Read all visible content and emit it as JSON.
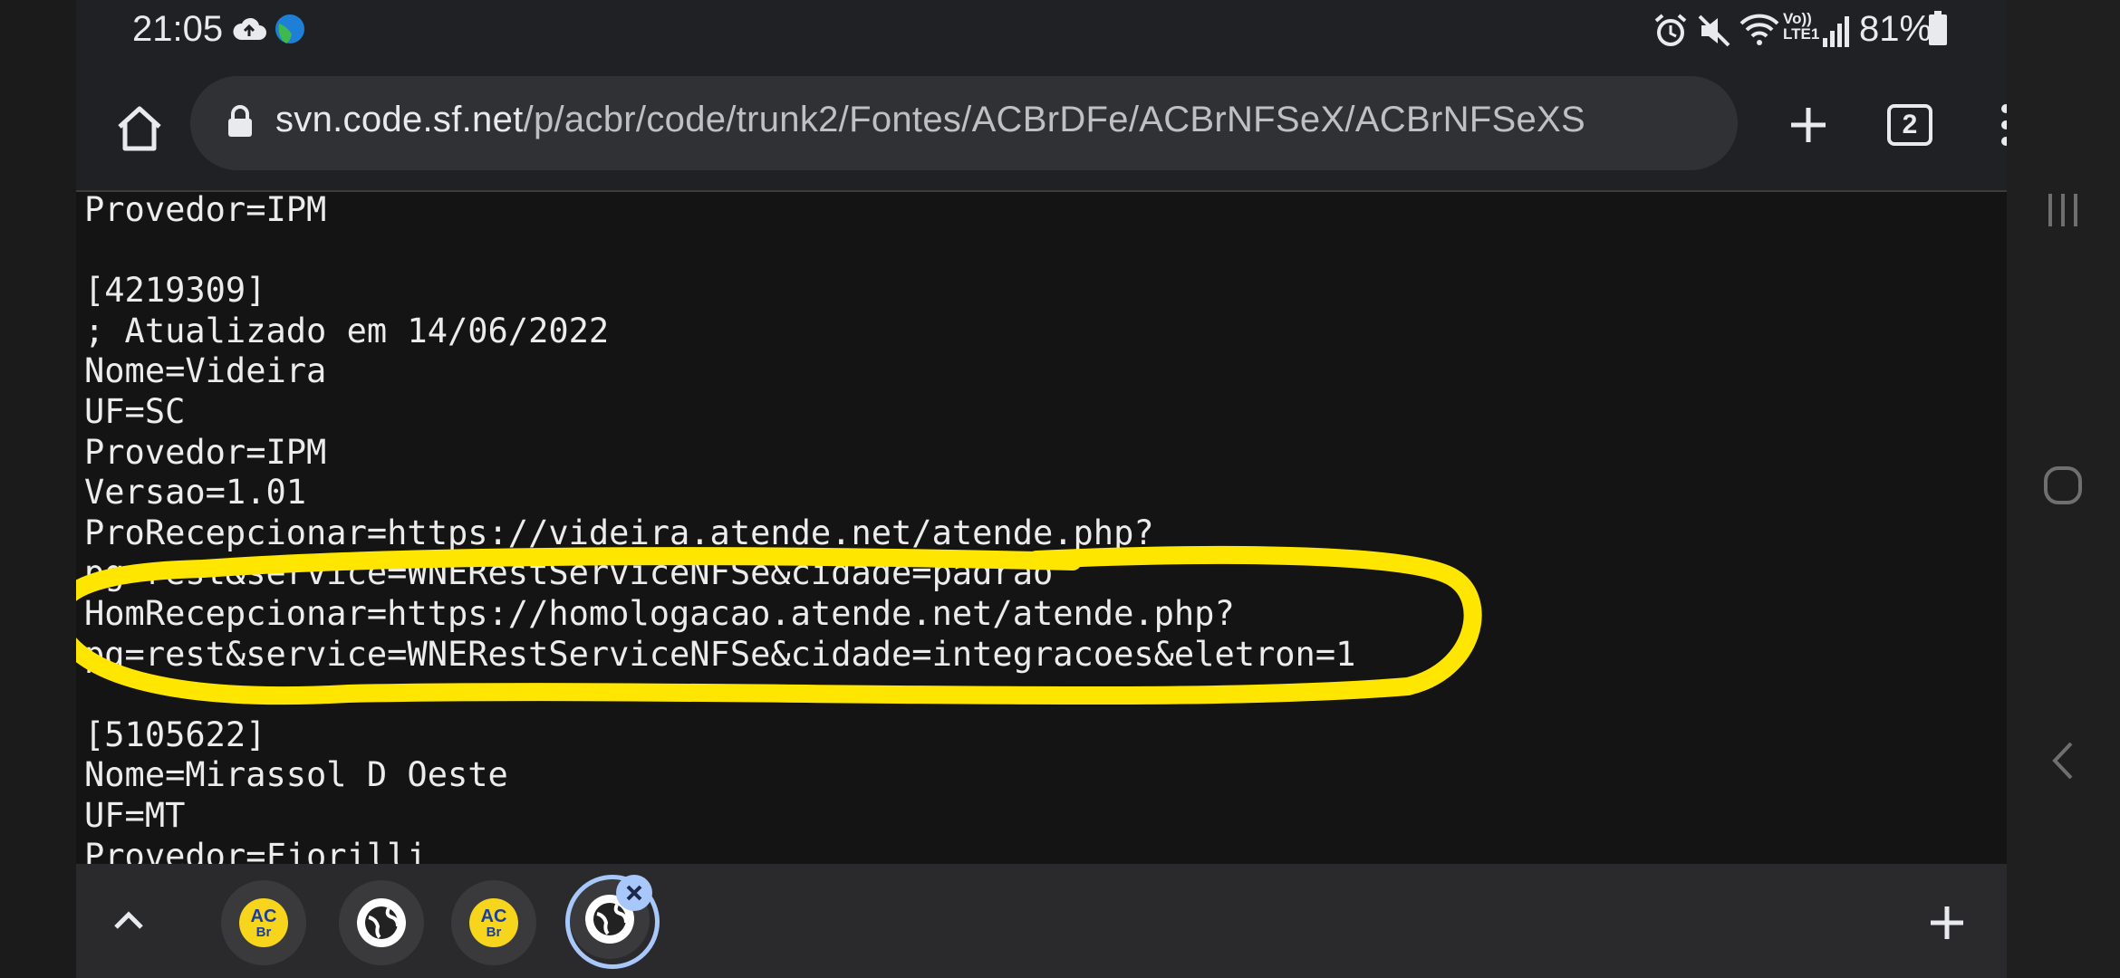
{
  "status_bar": {
    "time": "21:05",
    "left_icons": [
      "cloud-upload-icon",
      "app-notification-icon"
    ],
    "right_icons": [
      "alarm-icon",
      "mute-icon",
      "wifi-calling-icon",
      "volte-lte-icon",
      "signal-icon"
    ],
    "volte_line1": "Vo))",
    "volte_line2": "LTE1",
    "battery_percent": "81%"
  },
  "toolbar": {
    "url_host": "svn.code.sf.net",
    "url_path": "/p/acbr/code/trunk2/Fontes/ACBrDFe/ACBrNFSeX/ACBrNFSeXS",
    "tab_count": "2"
  },
  "content": {
    "lines": [
      "Provedor=IPM",
      "",
      "[4219309]",
      "; Atualizado em 14/06/2022",
      "Nome=Videira",
      "UF=SC",
      "Provedor=IPM",
      "Versao=1.01",
      "ProRecepcionar=https://videira.atende.net/atende.php?",
      "pg=rest&service=WNERestServiceNFSe&cidade=padrao",
      "HomRecepcionar=https://homologacao.atende.net/atende.php?",
      "pg=rest&service=WNERestServiceNFSe&cidade=integracoes&eletron=1",
      "",
      "[5105622]",
      "Nome=Mirassol D Oeste",
      "UF=MT",
      "Provedor=Fiorilli"
    ],
    "annotation_color": "#ffe600"
  },
  "tab_strip": {
    "tabs": [
      {
        "icon": "acbr-favicon",
        "ac": "AC",
        "br": "Br"
      },
      {
        "icon": "globe-icon"
      },
      {
        "icon": "acbr-favicon",
        "ac": "AC",
        "br": "Br"
      },
      {
        "icon": "globe-icon",
        "active": true
      }
    ],
    "accent": "#a8c7fa"
  },
  "nav_bar": {
    "buttons": [
      "recents-icon",
      "home-icon",
      "back-icon"
    ]
  }
}
